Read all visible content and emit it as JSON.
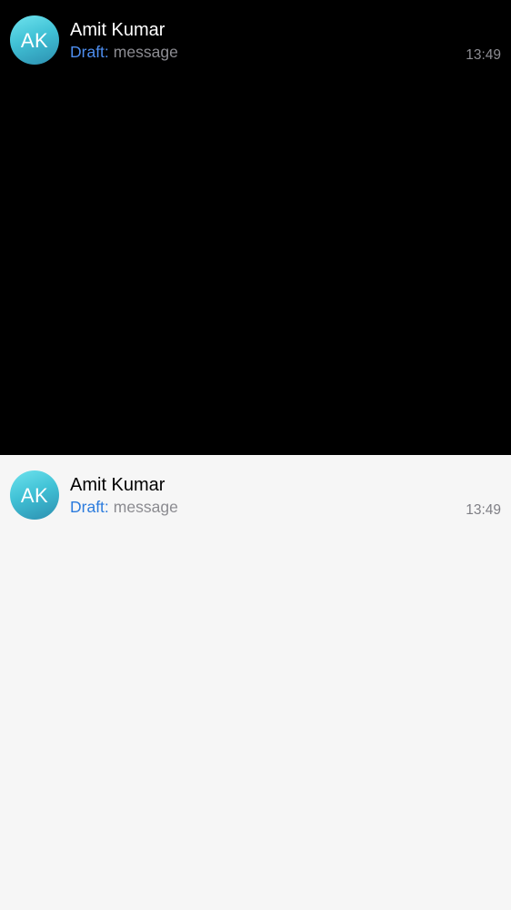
{
  "panes": [
    {
      "theme": "dark",
      "chat": {
        "avatar_initials": "AK",
        "name": "Amit Kumar",
        "draft_label": "Draft:",
        "draft_text": "message",
        "time": "13:49"
      }
    },
    {
      "theme": "light",
      "chat": {
        "avatar_initials": "AK",
        "name": "Amit Kumar",
        "draft_label": "Draft:",
        "draft_text": "message",
        "time": "13:49"
      }
    }
  ],
  "colors": {
    "dark_background": "#000000",
    "light_background": "#f6f6f6",
    "draft_accent": "#4d8ef0",
    "avatar_gradient": [
      "#6fe3ee",
      "#2c8fb0"
    ]
  }
}
